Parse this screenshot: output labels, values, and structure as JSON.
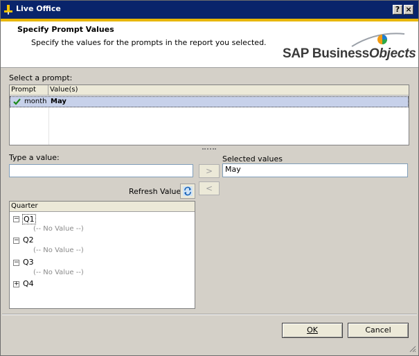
{
  "window": {
    "title": "Live Office",
    "help_label": "?",
    "close_label": "×"
  },
  "header": {
    "heading": "Specify Prompt Values",
    "description": "Specify the values for the prompts in the report you selected.",
    "logo_text_plain": "SAP Business",
    "logo_text_italic": "Objects",
    "logo_tm": "·"
  },
  "prompts": {
    "label": "Select a prompt:",
    "columns": [
      "Prompt",
      "Value(s)"
    ],
    "rows": [
      {
        "prompt": "month",
        "value": "May",
        "status": "check-icon"
      }
    ]
  },
  "value_entry": {
    "label": "Type a value:",
    "value": "",
    "refresh_label": "Refresh Values"
  },
  "selected": {
    "label": "Selected values",
    "value": "May"
  },
  "transfer": {
    "add_label": ">",
    "remove_label": "<"
  },
  "tree": {
    "column_header": "Quarter",
    "nodes": [
      {
        "label": "Q1",
        "expanded": true,
        "child": "(-- No Value --)"
      },
      {
        "label": "Q2",
        "expanded": true,
        "child": "(-- No Value --)"
      },
      {
        "label": "Q3",
        "expanded": true,
        "child": "(-- No Value --)"
      },
      {
        "label": "Q4",
        "expanded": false,
        "child": ""
      }
    ]
  },
  "footer": {
    "ok_label": "OK",
    "cancel_label": "Cancel"
  },
  "colors": {
    "titlebar": "#09246b",
    "header_stripe": "#e8b600",
    "selected_row": "#c7d1ea",
    "check": "#1a8a1a"
  }
}
